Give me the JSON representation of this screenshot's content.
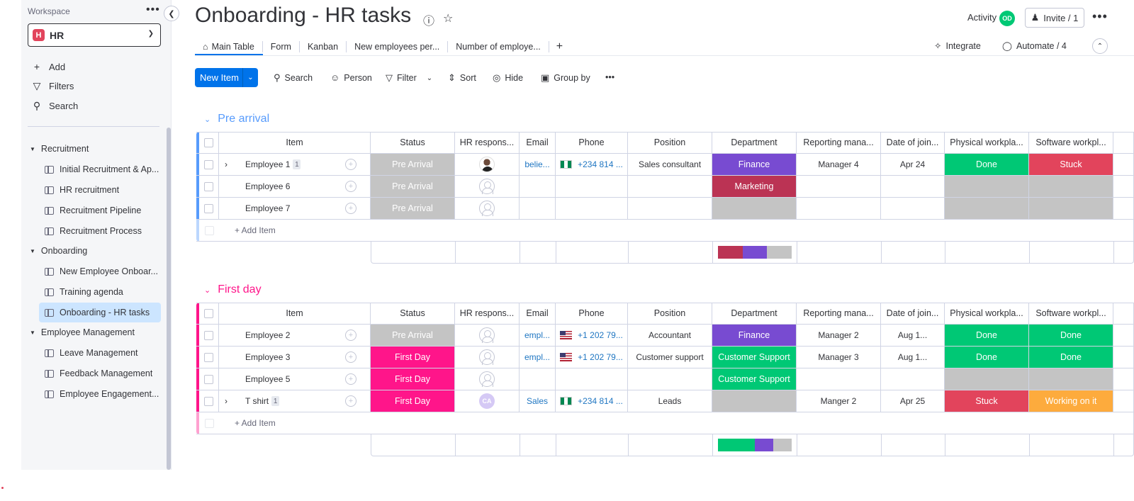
{
  "colors": {
    "primary": "#0073ea",
    "pre_arrival_group": "#579bfc",
    "first_day_group": "#ff158a",
    "status_gray": "#c4c4c4",
    "first_day": "#ff158a",
    "done": "#00c875",
    "stuck": "#e2445c",
    "working": "#fdab3d",
    "finance": "#784bd1",
    "marketing": "#bb3354",
    "customer_support": "#00c875"
  },
  "sidebar": {
    "workspace_label": "Workspace",
    "workspace_badge": "H",
    "workspace_name": "HR",
    "actions": [
      {
        "icon": "plus-icon",
        "label": "Add"
      },
      {
        "icon": "filter-icon",
        "label": "Filters"
      },
      {
        "icon": "search-icon",
        "label": "Search"
      }
    ],
    "folders": [
      {
        "label": "Recruitment",
        "boards": [
          "Initial Recruitment & Ap...",
          "HR recruitment",
          "Recruitment Pipeline",
          "Recruitment Process"
        ]
      },
      {
        "label": "Onboarding",
        "boards": [
          "New Employee Onboar...",
          "Training agenda",
          "Onboarding - HR tasks"
        ]
      },
      {
        "label": "Employee Management",
        "boards": [
          "Leave Management",
          "Feedback Management",
          "Employee Engagement..."
        ]
      }
    ]
  },
  "header": {
    "title": "Onboarding - HR tasks",
    "activity_label": "Activity",
    "activity_avatar": "OD",
    "invite_label": "Invite / 1"
  },
  "tabs": {
    "items": [
      "Main Table",
      "Form",
      "Kanban",
      "New employees per...",
      "Number of employe..."
    ],
    "plus": "+",
    "integrate": "Integrate",
    "automate": "Automate / 4"
  },
  "toolbar": {
    "new_item": "New Item",
    "search": "Search",
    "person": "Person",
    "filter": "Filter",
    "sort": "Sort",
    "hide": "Hide",
    "group_by": "Group by"
  },
  "columns": [
    "Item",
    "Status",
    "HR respons...",
    "Email",
    "Phone",
    "Position",
    "Department",
    "Reporting mana...",
    "Date of join...",
    "Physical workpla...",
    "Software workpl..."
  ],
  "groups": [
    {
      "title": "Pre arrival",
      "add_item": "+ Add Item",
      "rows": [
        {
          "item": "Employee 1",
          "subitems": "1",
          "status": "Pre Arrival",
          "status_color": "#c4c4c4",
          "person": "photo",
          "email": "belie...",
          "phone_flag": "ng",
          "phone": "+234 814 ...",
          "position": "Sales consultant",
          "department": "Finance",
          "dept_color": "#784bd1",
          "manager": "Manager 4",
          "date": "Apr 24",
          "physical": "Done",
          "physical_color": "#00c875",
          "software": "Stuck",
          "software_color": "#e2445c"
        },
        {
          "item": "Employee 6",
          "subitems": "",
          "status": "Pre Arrival",
          "status_color": "#c4c4c4",
          "person": "empty",
          "email": "",
          "phone_flag": "",
          "phone": "",
          "position": "",
          "department": "Marketing",
          "dept_color": "#bb3354",
          "manager": "",
          "date": "",
          "physical": "",
          "physical_color": "#c4c4c4",
          "software": "",
          "software_color": "#c4c4c4"
        },
        {
          "item": "Employee 7",
          "subitems": "",
          "status": "Pre Arrival",
          "status_color": "#c4c4c4",
          "person": "empty",
          "email": "",
          "phone_flag": "",
          "phone": "",
          "position": "",
          "department": "",
          "dept_color": "#c4c4c4",
          "manager": "",
          "date": "",
          "physical": "",
          "physical_color": "#c4c4c4",
          "software": "",
          "software_color": "#c4c4c4"
        }
      ],
      "dept_summary": [
        {
          "color": "#bb3354",
          "fraction": 0.333
        },
        {
          "color": "#784bd1",
          "fraction": 0.333
        },
        {
          "color": "#c4c4c4",
          "fraction": 0.334
        }
      ]
    },
    {
      "title": "First day",
      "add_item": "+ Add Item",
      "rows": [
        {
          "item": "Employee 2",
          "subitems": "",
          "status": "Pre Arrival",
          "status_color": "#c4c4c4",
          "person": "empty",
          "email": "empl...",
          "phone_flag": "us",
          "phone": "+1 202 79...",
          "position": "Accountant",
          "department": "Finance",
          "dept_color": "#784bd1",
          "manager": "Manager 2",
          "date": "Aug 1...",
          "physical": "Done",
          "physical_color": "#00c875",
          "software": "Done",
          "software_color": "#00c875"
        },
        {
          "item": "Employee 3",
          "subitems": "",
          "status": "First Day",
          "status_color": "#ff158a",
          "person": "empty",
          "email": "empl...",
          "phone_flag": "us",
          "phone": "+1 202 79...",
          "position": "Customer support",
          "department": "Customer Support",
          "dept_color": "#00c875",
          "manager": "Manager 3",
          "date": "Aug 1...",
          "physical": "Done",
          "physical_color": "#00c875",
          "software": "Done",
          "software_color": "#00c875"
        },
        {
          "item": "Employee 5",
          "subitems": "",
          "status": "First Day",
          "status_color": "#ff158a",
          "person": "empty",
          "email": "",
          "phone_flag": "",
          "phone": "",
          "position": "",
          "department": "Customer Support",
          "dept_color": "#00c875",
          "manager": "",
          "date": "",
          "physical": "",
          "physical_color": "#c4c4c4",
          "software": "",
          "software_color": "#c4c4c4"
        },
        {
          "item": "T shirt",
          "subitems": "1",
          "status": "First Day",
          "status_color": "#ff158a",
          "person": "CA",
          "email": "Sales",
          "phone_flag": "ng",
          "phone": "+234 814 ...",
          "position": "Leads",
          "department": "",
          "dept_color": "#c4c4c4",
          "manager": "Manger 2",
          "date": "Apr 25",
          "physical": "Stuck",
          "physical_color": "#e2445c",
          "software": "Working on it",
          "software_color": "#fdab3d"
        }
      ],
      "dept_summary": [
        {
          "color": "#00c875",
          "fraction": 0.5
        },
        {
          "color": "#784bd1",
          "fraction": 0.25
        },
        {
          "color": "#c4c4c4",
          "fraction": 0.25
        }
      ]
    }
  ]
}
